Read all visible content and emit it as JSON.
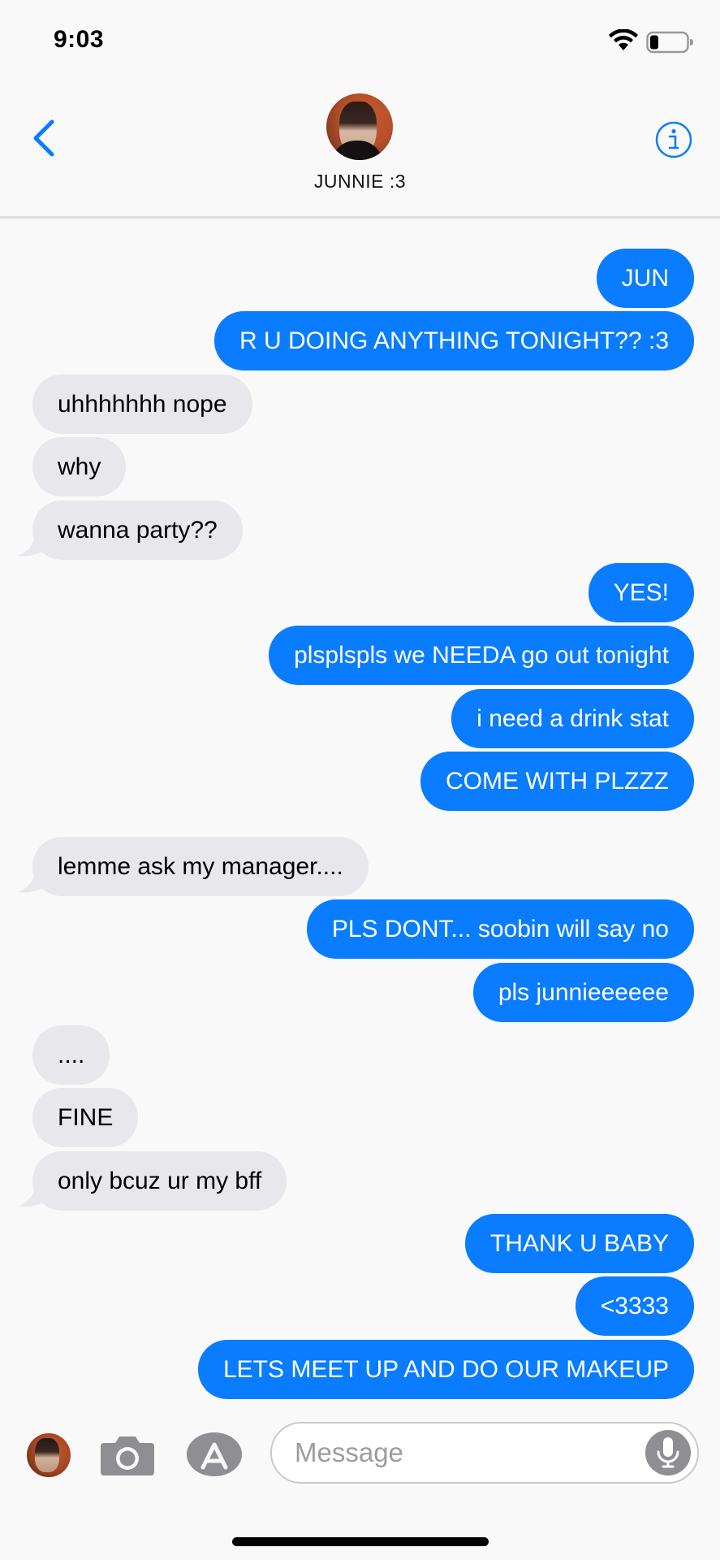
{
  "status_bar": {
    "time": "9:03"
  },
  "header": {
    "contact_name": "JUNNIE :3"
  },
  "messages": [
    {
      "text": "JUN",
      "dir": "sent"
    },
    {
      "text": "R U DOING ANYTHING TONIGHT?? :3",
      "dir": "sent"
    },
    {
      "text": "uhhhhhhh nope",
      "dir": "received"
    },
    {
      "text": "why",
      "dir": "received"
    },
    {
      "text": "wanna party??",
      "dir": "received"
    },
    {
      "text": "YES!",
      "dir": "sent"
    },
    {
      "text": "plsplspls we NEEDA go out tonight",
      "dir": "sent"
    },
    {
      "text": "i need a drink stat",
      "dir": "sent"
    },
    {
      "text": "COME WITH PLZZZ",
      "dir": "sent"
    },
    {
      "text": "lemme ask my manager....",
      "dir": "received"
    },
    {
      "text": "PLS DONT... soobin will say no",
      "dir": "sent"
    },
    {
      "text": "pls junnieeeeee",
      "dir": "sent"
    },
    {
      "text": "....",
      "dir": "received"
    },
    {
      "text": "FINE",
      "dir": "received"
    },
    {
      "text": "only bcuz ur my bff",
      "dir": "received"
    },
    {
      "text": "THANK U BABY",
      "dir": "sent"
    },
    {
      "text": "<3333",
      "dir": "sent"
    },
    {
      "text": "LETS MEET UP AND DO OUR MAKEUP",
      "dir": "sent"
    }
  ],
  "composer": {
    "placeholder": "Message"
  },
  "colors": {
    "sent_bubble": "#0a7cff",
    "received_bubble": "#e8e7ec",
    "accent": "#0a7cff"
  }
}
